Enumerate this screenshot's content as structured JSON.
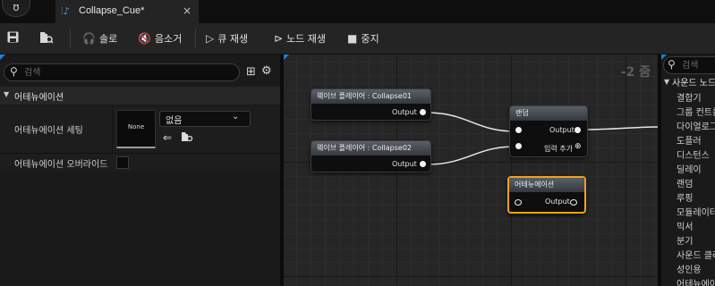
{
  "window": {
    "logo": "ʊ",
    "tab": {
      "icon": "cue-icon",
      "label": "Collapse_Cue*",
      "close": "×"
    }
  },
  "toolbar": {
    "save_icon": "save-icon",
    "browse_icon": "browse-icon",
    "solo_label": "솔로",
    "mute_label": "음소거",
    "play_cue_label": "큐 재생",
    "play_node_label": "노드 재생",
    "stop_label": "중지"
  },
  "details": {
    "search_placeholder": "검색",
    "category": "어테뉴에이션",
    "settings_label": "어테뉴에이션 세팅",
    "thumbnail_label": "None",
    "asset_value": "없음",
    "override_label": "어테뉴에이션 오버라이드",
    "override_checked": false
  },
  "graph": {
    "zoom": "-2 줌",
    "nodes": {
      "player1": {
        "title": "웨이브 플레이어 : Collapse01",
        "output": "Output"
      },
      "player2": {
        "title": "웨이브 플레이어 : Collapse02",
        "output": "Output"
      },
      "random": {
        "title": "랜덤",
        "output": "Output",
        "add_input": "입력 추가"
      },
      "attenuation": {
        "title": "어테뉴에이션",
        "input": "Output",
        "output": "Output",
        "selected_color": "#f0a21b"
      }
    }
  },
  "palette": {
    "search_placeholder": "검색",
    "category": "사운드 노드",
    "items": [
      "결합기",
      "그룹 컨트롤",
      "다이얼로그",
      "도플러",
      "디스턴스",
      "딜레이",
      "랜덤",
      "루핑",
      "모듈레이터",
      "믹서",
      "분기",
      "사운드 클래스",
      "성인용",
      "어테뉴에이션"
    ]
  }
}
